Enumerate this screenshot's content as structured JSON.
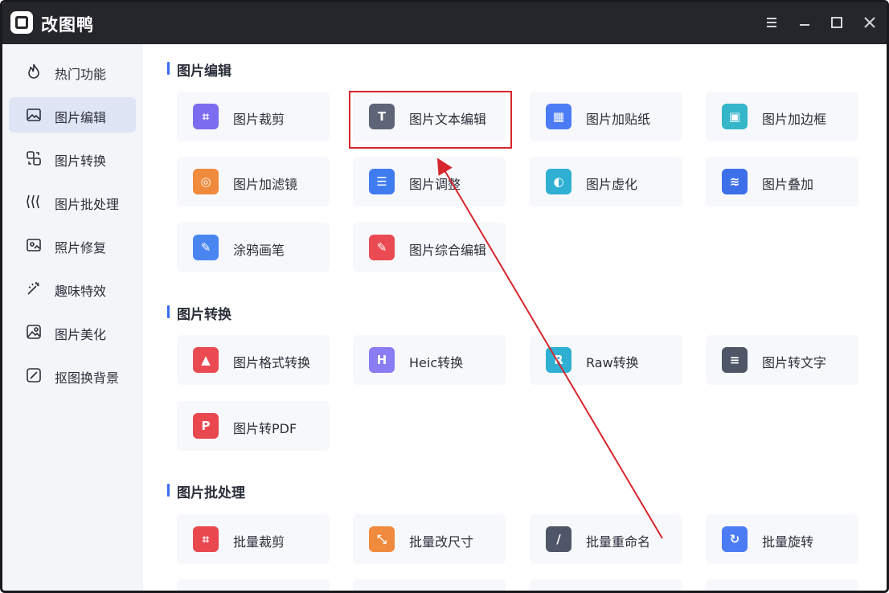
{
  "app": {
    "title": "改图鸭"
  },
  "window_controls": [
    {
      "name": "menu-icon"
    },
    {
      "name": "minimize-icon"
    },
    {
      "name": "maximize-icon"
    },
    {
      "name": "close-icon"
    }
  ],
  "sidebar": {
    "items": [
      {
        "label": "热门功能",
        "icon": "flame-icon",
        "active": false
      },
      {
        "label": "图片编辑",
        "icon": "image-edit-icon",
        "active": true
      },
      {
        "label": "图片转换",
        "icon": "convert-icon",
        "active": false
      },
      {
        "label": "图片批处理",
        "icon": "batch-icon",
        "active": false
      },
      {
        "label": "照片修复",
        "icon": "photo-repair-icon",
        "active": false
      },
      {
        "label": "趣味特效",
        "icon": "magic-wand-icon",
        "active": false
      },
      {
        "label": "图片美化",
        "icon": "beautify-icon",
        "active": false
      },
      {
        "label": "抠图换背景",
        "icon": "cutout-icon",
        "active": false
      }
    ]
  },
  "sections": [
    {
      "title": "图片编辑",
      "items": [
        {
          "label": "图片裁剪",
          "icon": "crop-icon",
          "color": "#7b6cf0"
        },
        {
          "label": "图片文本编辑",
          "icon": "text-edit-icon",
          "color": "#5d6577"
        },
        {
          "label": "图片加贴纸",
          "icon": "sticker-icon",
          "color": "#4b7cf5"
        },
        {
          "label": "图片加边框",
          "icon": "frame-border-icon",
          "color": "#35b6c9"
        },
        {
          "label": "图片加滤镜",
          "icon": "filter-icon",
          "color": "#f08a3c"
        },
        {
          "label": "图片调整",
          "icon": "adjust-icon",
          "color": "#3f7cf0"
        },
        {
          "label": "图片虚化",
          "icon": "blur-icon",
          "color": "#2fb0d3"
        },
        {
          "label": "图片叠加",
          "icon": "layers-icon",
          "color": "#3d6fe8"
        },
        {
          "label": "涂鸦画笔",
          "icon": "brush-icon",
          "color": "#4a86f0"
        },
        {
          "label": "图片综合编辑",
          "icon": "all-edit-icon",
          "color": "#ea4b52"
        }
      ]
    },
    {
      "title": "图片转换",
      "items": [
        {
          "label": "图片格式转换",
          "icon": "format-convert-icon",
          "color": "#ea4b52"
        },
        {
          "label": "Heic转换",
          "icon": "heic-icon",
          "color": "#8a7cf2"
        },
        {
          "label": "Raw转换",
          "icon": "raw-icon",
          "color": "#2fb0d3"
        },
        {
          "label": "图片转文字",
          "icon": "image-to-text-icon",
          "color": "#4e5667"
        },
        {
          "label": "图片转PDF",
          "icon": "pdf-icon",
          "color": "#e9484f"
        }
      ]
    },
    {
      "title": "图片批处理",
      "items": [
        {
          "label": "批量裁剪",
          "icon": "batch-crop-icon",
          "color": "#e9484f"
        },
        {
          "label": "批量改尺寸",
          "icon": "batch-resize-icon",
          "color": "#f08a3c"
        },
        {
          "label": "批量重命名",
          "icon": "batch-rename-icon",
          "color": "#4e5667"
        },
        {
          "label": "批量旋转",
          "icon": "batch-rotate-icon",
          "color": "#4b7cf5"
        }
      ]
    }
  ],
  "colors": {
    "accent": "#3a6cf0",
    "annotation": "#d7262d",
    "titlebar": "#25262b"
  }
}
